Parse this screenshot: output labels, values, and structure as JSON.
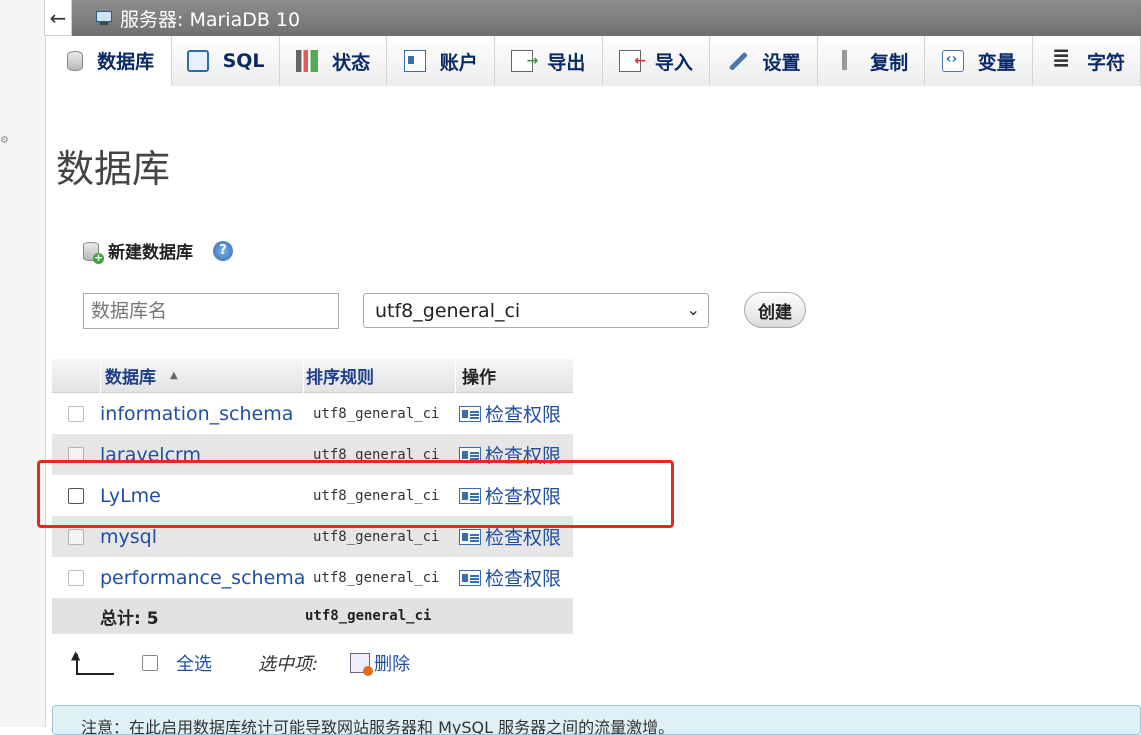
{
  "server_bar": {
    "title": "服务器: MariaDB 10"
  },
  "nav": {
    "collapse": "←"
  },
  "tabs": [
    {
      "label": "数据库",
      "icon": "database-icon"
    },
    {
      "label": "SQL",
      "icon": "sql-icon"
    },
    {
      "label": "状态",
      "icon": "status-icon"
    },
    {
      "label": "账户",
      "icon": "accounts-icon"
    },
    {
      "label": "导出",
      "icon": "export-icon"
    },
    {
      "label": "导入",
      "icon": "import-icon"
    },
    {
      "label": "设置",
      "icon": "wrench-icon"
    },
    {
      "label": "复制",
      "icon": "replication-icon"
    },
    {
      "label": "变量",
      "icon": "variables-icon"
    },
    {
      "label": "字符",
      "icon": "charset-icon"
    }
  ],
  "page_title": "数据库",
  "create": {
    "heading": "新建数据库",
    "help": "?",
    "name_placeholder": "数据库名",
    "collation_selected": "utf8_general_ci",
    "submit_label": "创建"
  },
  "table": {
    "headers": {
      "name": "数据库",
      "collation": "排序规则",
      "action": "操作"
    },
    "rows": [
      {
        "name": "information_schema",
        "collation": "utf8_general_ci",
        "action": "检查权限"
      },
      {
        "name": "laravelcrm",
        "collation": "utf8_general_ci",
        "action": "检查权限"
      },
      {
        "name": "LyLme",
        "collation": "utf8_general_ci",
        "action": "检查权限"
      },
      {
        "name": "mysql",
        "collation": "utf8_general_ci",
        "action": "检查权限"
      },
      {
        "name": "performance_schema",
        "collation": "utf8_general_ci",
        "action": "检查权限"
      }
    ],
    "footer": {
      "total": "总计: 5",
      "collation": "utf8_general_ci"
    }
  },
  "bulk": {
    "select_all": "全选",
    "with_selected": "选中项:",
    "delete": "删除"
  },
  "notice": "注意：在此启用数据库统计可能导致网站服务器和 MySQL 服务器之间的流量激增。",
  "colors": {
    "link": "#1f4fa3",
    "highlight": "#e8281f",
    "server_bar": "#7a7a7a"
  }
}
